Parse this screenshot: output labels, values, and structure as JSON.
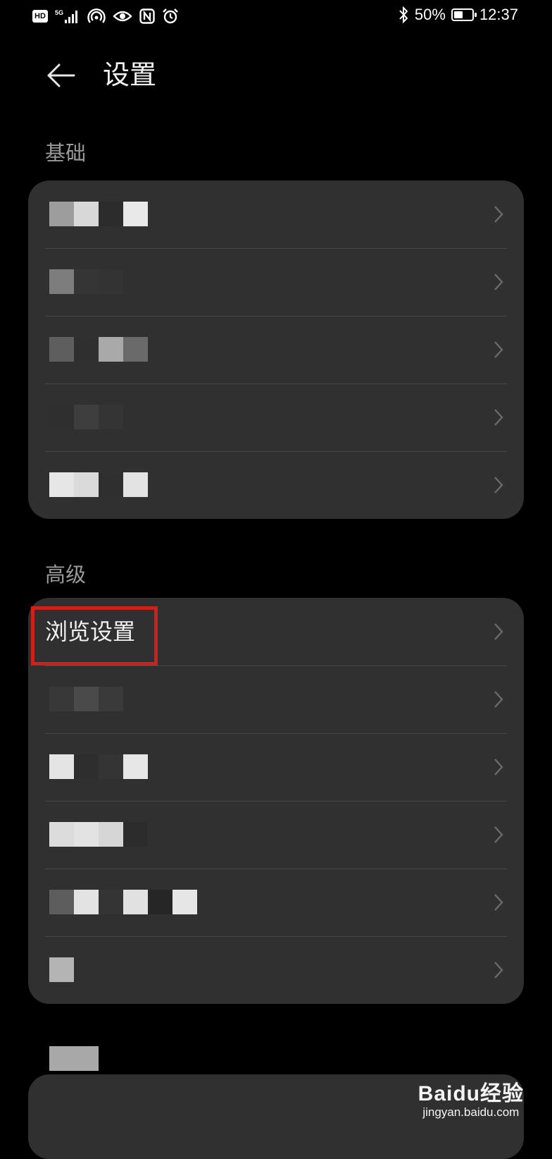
{
  "status_bar": {
    "network_badge": "HD",
    "network_type": "5G",
    "battery_percent": "50%",
    "battery_level": 0.5,
    "time": "12:37",
    "icons": [
      "signal-icon",
      "hotspot-icon",
      "eye-icon",
      "nfc-icon",
      "alarm-icon",
      "bluetooth-icon",
      "battery-icon"
    ]
  },
  "header": {
    "title": "设置",
    "back_icon": "arrow-left-icon"
  },
  "sections": [
    {
      "title": "基础",
      "items": [
        {
          "label": "",
          "obscured": true
        },
        {
          "label": "",
          "obscured": true
        },
        {
          "label": "",
          "obscured": true
        },
        {
          "label": "",
          "obscured": true
        },
        {
          "label": "",
          "obscured": true
        }
      ]
    },
    {
      "title": "高级",
      "items": [
        {
          "label": "浏览设置",
          "obscured": false,
          "highlighted": true
        },
        {
          "label": "",
          "obscured": true
        },
        {
          "label": "",
          "obscured": true
        },
        {
          "label": "",
          "obscured": true
        },
        {
          "label": "",
          "obscured": true
        },
        {
          "label": "",
          "obscured": true
        }
      ]
    }
  ],
  "colors": {
    "background": "#000000",
    "card": "#303030",
    "divider": "#474747",
    "section_header": "#9a9a9a",
    "highlight": "#d0201a"
  },
  "watermark": {
    "logo": "Baidu经验",
    "url": "jingyan.baidu.com"
  }
}
